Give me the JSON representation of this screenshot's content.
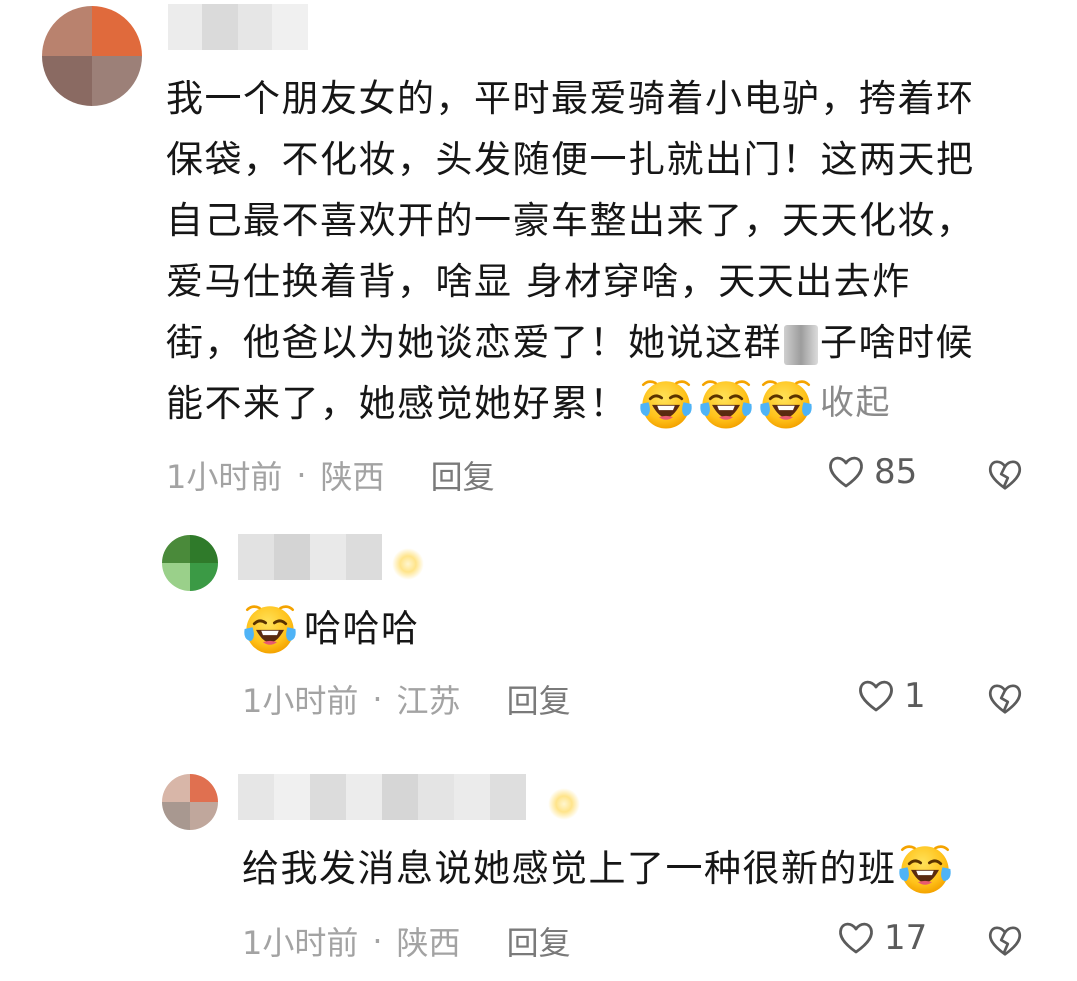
{
  "comments": [
    {
      "lines": [
        "我一个朋友女的，平时最爱骑着小电驴，挎着环",
        "保袋，不化妆，头发随便一扎就出门！这两天把",
        "自己最不喜欢开的一豪车整出来了，天天化妆，",
        "爱马仕换着背，啥显 身材穿啥，天天出去炸",
        "街，他爸以为她谈恋爱了！她说这群",
        "子啥时候",
        "能不来了，她感觉她好累！"
      ],
      "collapse_label": "收起",
      "time": "1小时前",
      "location": "陕西",
      "reply_label": "回复",
      "likes": "85"
    },
    {
      "text": "哈哈哈",
      "time": "1小时前",
      "location": "江苏",
      "reply_label": "回复",
      "likes": "1"
    },
    {
      "text": "给我发消息说她感觉上了一种很新的班",
      "time": "1小时前",
      "location": "陕西",
      "reply_label": "回复",
      "likes": "17"
    }
  ],
  "separator": "·",
  "icons": {
    "like": "heart-outline-icon",
    "dislike": "broken-heart-icon",
    "emoji": "face-with-tears-of-joy-emoji"
  },
  "colors": {
    "text": "#161616",
    "meta": "#a3a3a3",
    "collapse": "#8a8a8a"
  }
}
